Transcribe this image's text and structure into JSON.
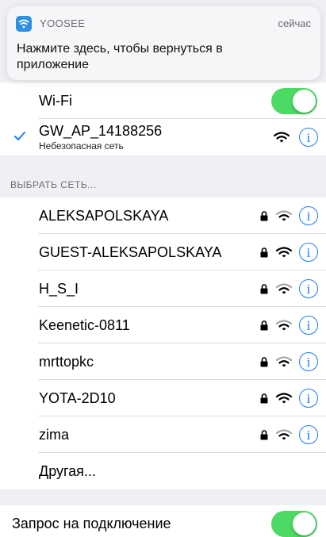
{
  "notification": {
    "app_name": "YOOSEE",
    "time": "сейчас",
    "message": "Нажмите здесь, чтобы вернуться в приложение",
    "icon": "yoosee-app-icon"
  },
  "wifi": {
    "label": "Wi-Fi",
    "enabled": true
  },
  "connected_network": {
    "name": "GW_AP_14188256",
    "subtitle": "Небезопасная сеть",
    "secured": false
  },
  "networks_header": "ВЫБРАТЬ СЕТЬ...",
  "networks": [
    {
      "name": "ALEKSAPOLSKAYA",
      "locked": true,
      "signal": 2
    },
    {
      "name": "GUEST-ALEKSAPOLSKAYA",
      "locked": true,
      "signal": 3
    },
    {
      "name": "H_S_I",
      "locked": true,
      "signal": 2
    },
    {
      "name": "Keenetic-0811",
      "locked": true,
      "signal": 2
    },
    {
      "name": "mrttopkc",
      "locked": true,
      "signal": 2
    },
    {
      "name": "YOTA-2D10",
      "locked": true,
      "signal": 3
    },
    {
      "name": "zima",
      "locked": true,
      "signal": 2
    }
  ],
  "other_label": "Другая...",
  "ask_to_join": {
    "label": "Запрос на подключение",
    "enabled": true
  },
  "colors": {
    "accent": "#1a7cf5",
    "toggle_on": "#4cd964",
    "background": "#efeff4"
  }
}
